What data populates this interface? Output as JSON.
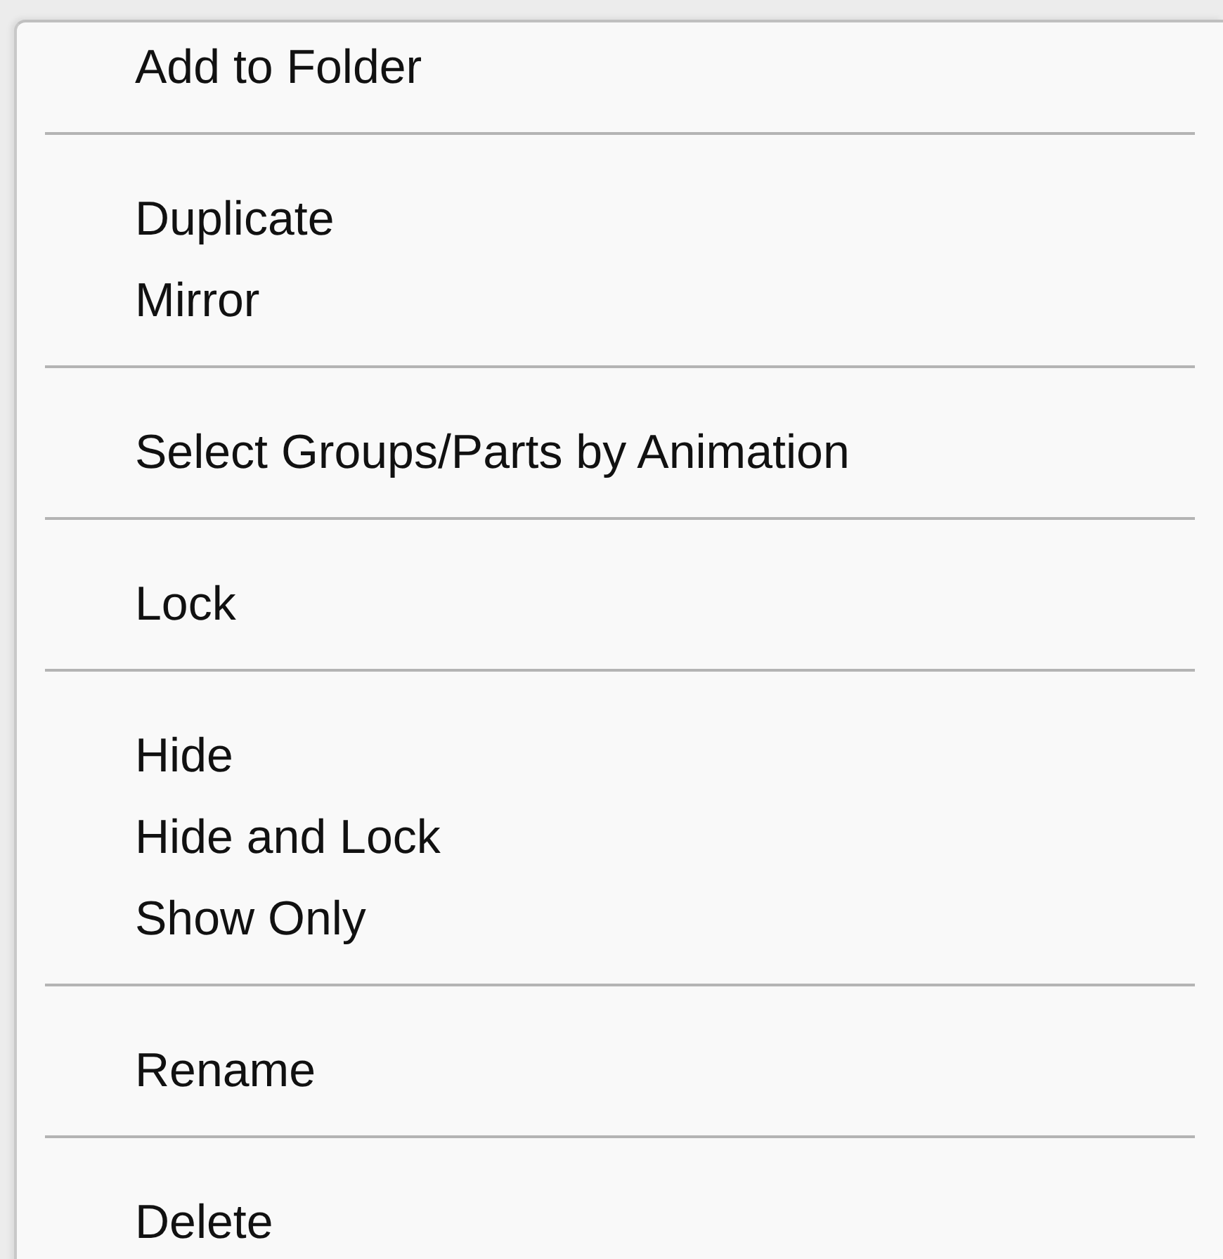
{
  "context_menu": {
    "sections": [
      {
        "items": [
          "Add to Folder"
        ]
      },
      {
        "items": [
          "Duplicate",
          "Mirror"
        ]
      },
      {
        "items": [
          "Select Groups/Parts by Animation"
        ]
      },
      {
        "items": [
          "Lock"
        ]
      },
      {
        "items": [
          "Hide",
          "Hide and Lock",
          "Show Only"
        ]
      },
      {
        "items": [
          "Rename"
        ]
      },
      {
        "items": [
          "Delete"
        ]
      }
    ]
  }
}
